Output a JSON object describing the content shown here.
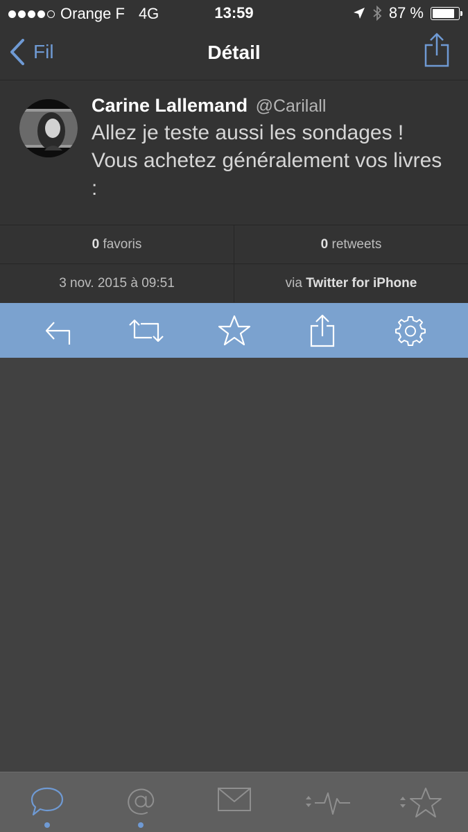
{
  "status_bar": {
    "carrier": "Orange F",
    "network": "4G",
    "time": "13:59",
    "battery": "87 %",
    "battery_level": 0.87
  },
  "nav": {
    "back_label": "Fil",
    "title": "Détail"
  },
  "tweet": {
    "author_name": "Carine Lallemand",
    "author_handle": "@Carilall",
    "text": "Allez je teste aussi les sondages ! Vous achetez généralement vos livres :"
  },
  "stats": {
    "favorites_count": "0",
    "favorites_label": "favoris",
    "retweets_count": "0",
    "retweets_label": "retweets",
    "date": "3 nov. 2015 à 09:51",
    "via_prefix": "via",
    "via_app": "Twitter for iPhone"
  },
  "actions": [
    "reply-icon",
    "retweet-icon",
    "star-icon",
    "share-icon",
    "gear-icon"
  ],
  "tabs": [
    "speech-bubble-icon",
    "at-sign-icon",
    "envelope-icon",
    "activity-icon",
    "favorites-star-icon"
  ],
  "colors": {
    "accent": "#6f9ad4",
    "action_bar": "#7ba2cf",
    "header_bg": "#333333",
    "content_bg": "#414141",
    "tab_bar_bg": "#5f5f5f"
  }
}
